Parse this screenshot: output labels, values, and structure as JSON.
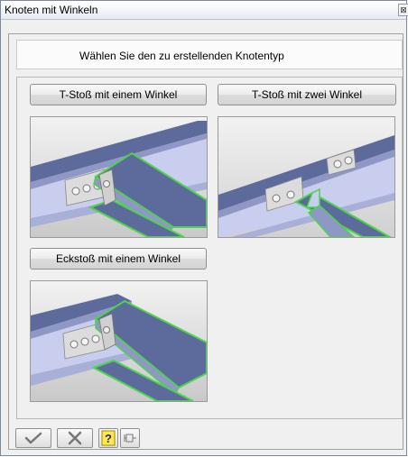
{
  "window": {
    "title": "Knoten mit Winkeln",
    "close_glyph": "⊠"
  },
  "prompt": "Wählen Sie den zu erstellenden Knotentyp",
  "options": [
    {
      "label": "T-Stoß mit einem Winkel",
      "preview": "t-joint-single-angle"
    },
    {
      "label": "T-Stoß mit zwei Winkel",
      "preview": "t-joint-double-angle"
    },
    {
      "label": "Eckstoß mit einem Winkel",
      "preview": "corner-joint-single-angle"
    }
  ],
  "toolbar": {
    "ok_icon": "checkmark-icon",
    "cancel_icon": "x-icon",
    "help_icon": "question-mark-icon",
    "pin_icon": "pin-icon"
  },
  "colors": {
    "steel_top": "#5d6a9c",
    "steel_side": "#c3c8ea",
    "highlight": "#4cd44c",
    "plate": "#d7d7d7"
  }
}
